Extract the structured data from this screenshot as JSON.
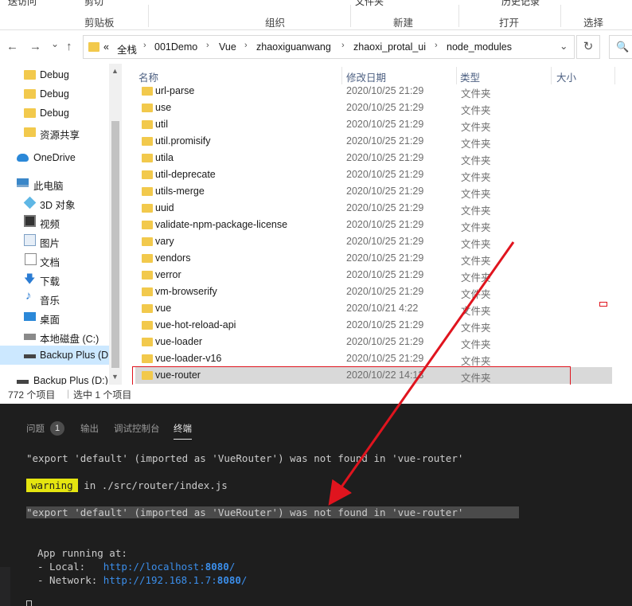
{
  "ribbon": {
    "cut_partial": "送访问",
    "clip_partial": "剪切",
    "file_partial": "文件夹",
    "history_partial": "历史记录",
    "groups": [
      "剪贴板",
      "组织",
      "新建",
      "打开",
      "选择"
    ]
  },
  "address": {
    "overflow": "«",
    "crumbs": [
      "全栈",
      "001Demo",
      "Vue",
      "zhaoxiguanwang",
      "zhaoxi_protal_ui",
      "node_modules"
    ]
  },
  "nav": {
    "back": "←",
    "forward": "→",
    "recent": "⌄",
    "up": "↑",
    "dropdown": "⌄",
    "refresh": "↻",
    "search": "🔍"
  },
  "navpane": [
    {
      "label": "Debug",
      "icon": "folder-icon"
    },
    {
      "label": "Debug",
      "icon": "folder-icon"
    },
    {
      "label": "Debug",
      "icon": "folder-icon"
    },
    {
      "label": "资源共享",
      "icon": "folder-icon"
    },
    {
      "label": "OneDrive",
      "icon": "onedrive-icon"
    },
    {
      "label": "此电脑",
      "icon": "computer-icon"
    },
    {
      "label": "3D 对象",
      "icon": "3d-objects-icon"
    },
    {
      "label": "视频",
      "icon": "video-icon"
    },
    {
      "label": "图片",
      "icon": "pictures-icon"
    },
    {
      "label": "文档",
      "icon": "documents-icon"
    },
    {
      "label": "下载",
      "icon": "downloads-icon"
    },
    {
      "label": "音乐",
      "icon": "music-icon"
    },
    {
      "label": "桌面",
      "icon": "desktop-icon"
    },
    {
      "label": "本地磁盘 (C:)",
      "icon": "local-disk-icon"
    },
    {
      "label": "Backup Plus (D",
      "icon": "drive-icon"
    },
    {
      "label": "Backup Plus (D:)",
      "icon": "drive-icon"
    }
  ],
  "columns": {
    "name": "名称",
    "modified": "修改日期",
    "type": "类型",
    "size": "大小"
  },
  "files": [
    {
      "name": "url-parse",
      "date": "2020/10/25 21:29",
      "type": "文件夹"
    },
    {
      "name": "use",
      "date": "2020/10/25 21:29",
      "type": "文件夹"
    },
    {
      "name": "util",
      "date": "2020/10/25 21:29",
      "type": "文件夹"
    },
    {
      "name": "util.promisify",
      "date": "2020/10/25 21:29",
      "type": "文件夹"
    },
    {
      "name": "utila",
      "date": "2020/10/25 21:29",
      "type": "文件夹"
    },
    {
      "name": "util-deprecate",
      "date": "2020/10/25 21:29",
      "type": "文件夹"
    },
    {
      "name": "utils-merge",
      "date": "2020/10/25 21:29",
      "type": "文件夹"
    },
    {
      "name": "uuid",
      "date": "2020/10/25 21:29",
      "type": "文件夹"
    },
    {
      "name": "validate-npm-package-license",
      "date": "2020/10/25 21:29",
      "type": "文件夹"
    },
    {
      "name": "vary",
      "date": "2020/10/25 21:29",
      "type": "文件夹"
    },
    {
      "name": "vendors",
      "date": "2020/10/25 21:29",
      "type": "文件夹"
    },
    {
      "name": "verror",
      "date": "2020/10/25 21:29",
      "type": "文件夹"
    },
    {
      "name": "vm-browserify",
      "date": "2020/10/25 21:29",
      "type": "文件夹"
    },
    {
      "name": "vue",
      "date": "2020/10/21 4:22",
      "type": "文件夹"
    },
    {
      "name": "vue-hot-reload-api",
      "date": "2020/10/25 21:29",
      "type": "文件夹"
    },
    {
      "name": "vue-loader",
      "date": "2020/10/25 21:29",
      "type": "文件夹"
    },
    {
      "name": "vue-loader-v16",
      "date": "2020/10/25 21:29",
      "type": "文件夹"
    },
    {
      "name": "vue-router",
      "date": "2020/10/22 14:13",
      "type": "文件夹",
      "selected": true
    }
  ],
  "status": {
    "count": "772 个项目",
    "selected": "选中 1 个项目"
  },
  "terminal": {
    "tabs": {
      "problems": "问题",
      "problems_count": "1",
      "output": "输出",
      "debug_console": "调试控制台",
      "terminal": "终端"
    },
    "line1": "\"export 'default' (imported as 'VueRouter') was not found in 'vue-router'",
    "warning_tag": "warning",
    "warning_rest": " in ./src/router/index.js",
    "line3": "\"export 'default' (imported as 'VueRouter') was not found in 'vue-router'",
    "running": "App running at:",
    "local_label": "- Local:   ",
    "local_url": "http://localhost:",
    "local_port": "8080",
    "local_slash": "/",
    "network_label": "- Network: ",
    "network_url": "http://192.168.1.7:",
    "network_port": "8080",
    "network_slash": "/"
  }
}
